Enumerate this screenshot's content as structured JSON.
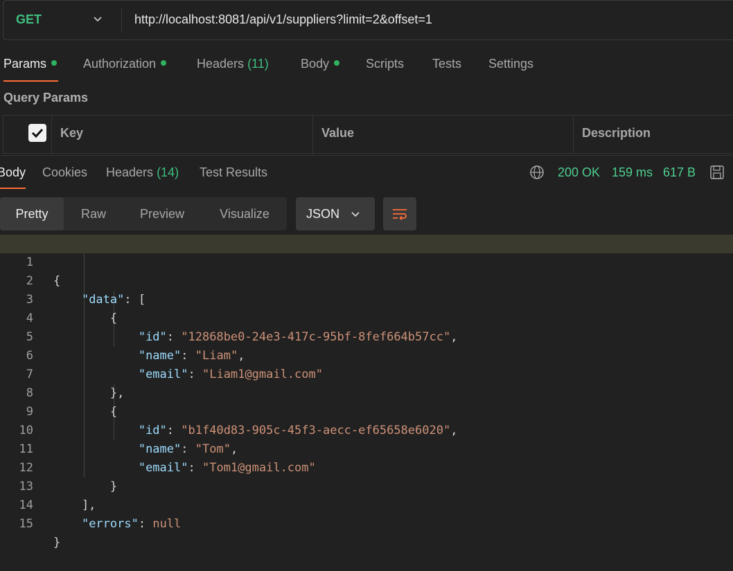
{
  "request": {
    "method": "GET",
    "url": "http://localhost:8081/api/v1/suppliers?limit=2&offset=1"
  },
  "request_tabs": [
    {
      "label": "Params",
      "dot": true,
      "active": true
    },
    {
      "label": "Authorization",
      "dot": true
    },
    {
      "label": "Headers",
      "count": "(11)"
    },
    {
      "label": "Body",
      "dot": true
    },
    {
      "label": "Scripts"
    },
    {
      "label": "Tests"
    },
    {
      "label": "Settings"
    }
  ],
  "query_params": {
    "title": "Query Params",
    "columns": [
      "Key",
      "Value",
      "Description"
    ]
  },
  "response": {
    "tabs": [
      {
        "label": "Body",
        "active": true
      },
      {
        "label": "Cookies"
      },
      {
        "label": "Headers",
        "count": "(14)"
      },
      {
        "label": "Test Results"
      }
    ],
    "status": "200 OK",
    "time": "159 ms",
    "size": "617 B",
    "view_modes": [
      "Pretty",
      "Raw",
      "Preview",
      "Visualize"
    ],
    "active_view": "Pretty",
    "language": "JSON",
    "line_numbers": [
      "1",
      "2",
      "3",
      "4",
      "5",
      "6",
      "7",
      "8",
      "9",
      "10",
      "11",
      "12",
      "13",
      "14",
      "15"
    ],
    "json": {
      "data": [
        {
          "id": "12868be0-24e3-417c-95bf-8fef664b57cc",
          "name": "Liam",
          "email": "Liam1@gmail.com"
        },
        {
          "id": "b1f40d83-905c-45f3-aecc-ef65658e6020",
          "name": "Tom",
          "email": "Tom1@gmail.com"
        }
      ],
      "errors": "null"
    }
  },
  "colors": {
    "accent": "#ff6c37",
    "method": "#3fbf7f",
    "status_ok": "#4fcf8f",
    "json_key": "#9cdcfe",
    "json_string": "#ce9178"
  }
}
